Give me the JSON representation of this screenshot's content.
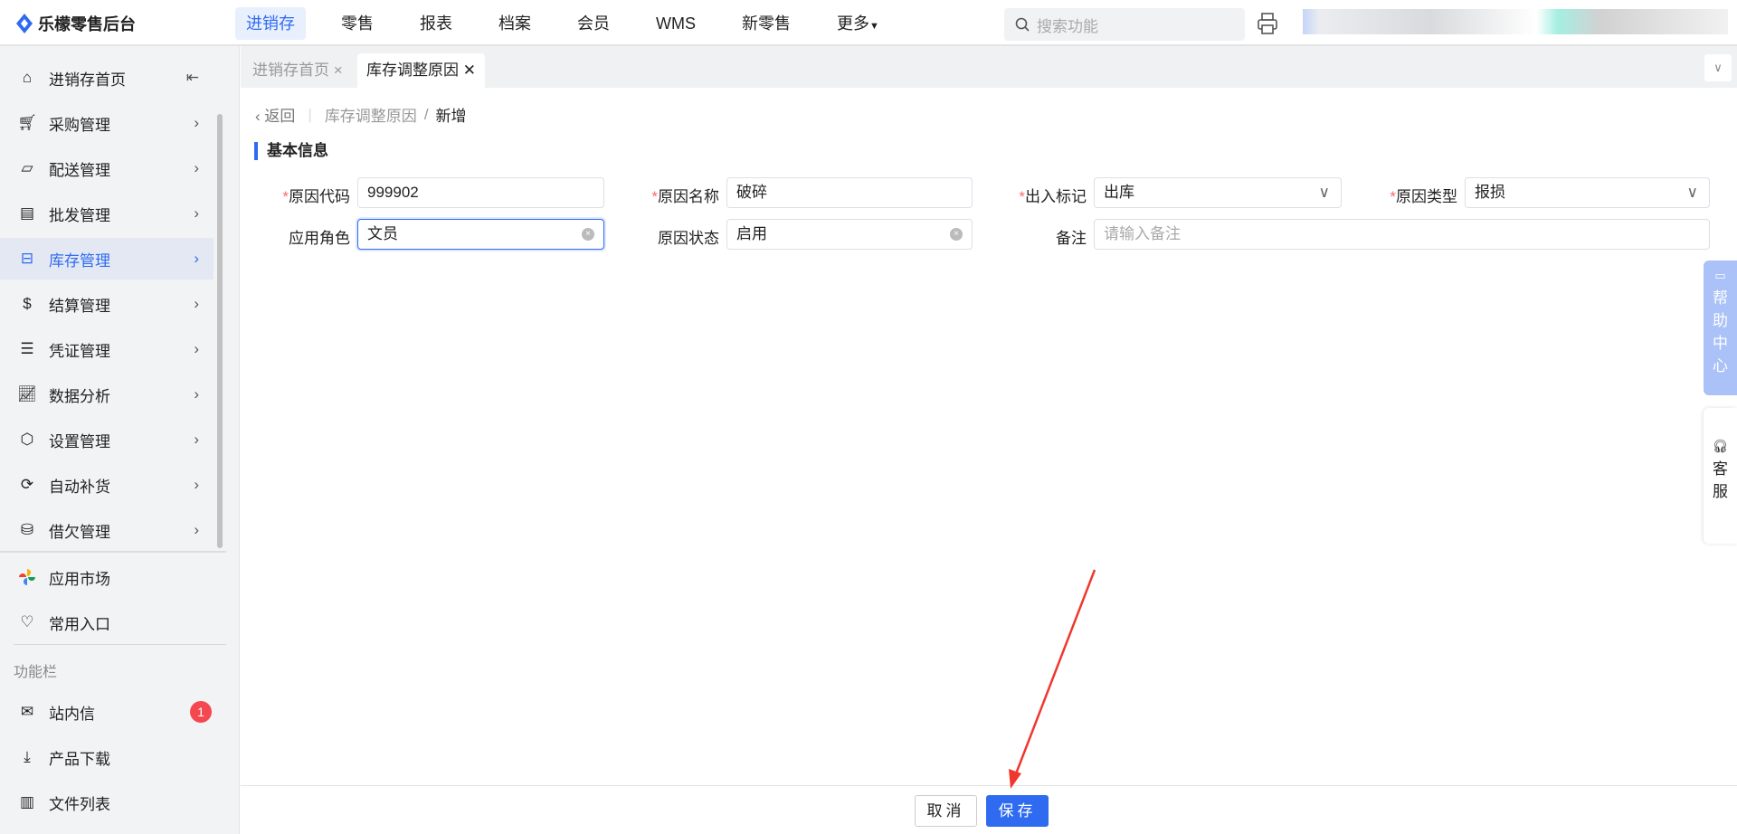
{
  "app": {
    "title": "乐檬零售后台"
  },
  "nav": [
    "进销存",
    "零售",
    "报表",
    "档案",
    "会员",
    "WMS",
    "新零售",
    "更多"
  ],
  "search": {
    "placeholder": "搜索功能"
  },
  "sidebar": {
    "items": [
      "进销存首页",
      "采购管理",
      "配送管理",
      "批发管理",
      "库存管理",
      "结算管理",
      "凭证管理",
      "数据分析",
      "设置管理",
      "自动补货",
      "借欠管理"
    ],
    "extra": [
      "应用市场",
      "常用入口"
    ],
    "section": "功能栏",
    "tools": [
      "站内信",
      "产品下载",
      "文件列表"
    ],
    "badge": "1"
  },
  "tabs": [
    "进销存首页",
    "库存调整原因"
  ],
  "breadcrumb": {
    "back": "返回",
    "parent": "库存调整原因",
    "current": "新增"
  },
  "section_title": "基本信息",
  "form": {
    "code": {
      "label": "原因代码",
      "value": "999902"
    },
    "name": {
      "label": "原因名称",
      "value": "破碎"
    },
    "flag": {
      "label": "出入标记",
      "value": "出库"
    },
    "type": {
      "label": "原因类型",
      "value": "报损"
    },
    "role": {
      "label": "应用角色",
      "value": "文员"
    },
    "status": {
      "label": "原因状态",
      "value": "启用"
    },
    "remark": {
      "label": "备注",
      "placeholder": "请输入备注"
    }
  },
  "float": {
    "help": "帮助中心",
    "service": "客服"
  },
  "buttons": {
    "cancel": "取消",
    "save": "保存"
  },
  "colors": {
    "accent": "#2f6bf0",
    "required": "#f56c6c",
    "badge": "#f5474f"
  }
}
